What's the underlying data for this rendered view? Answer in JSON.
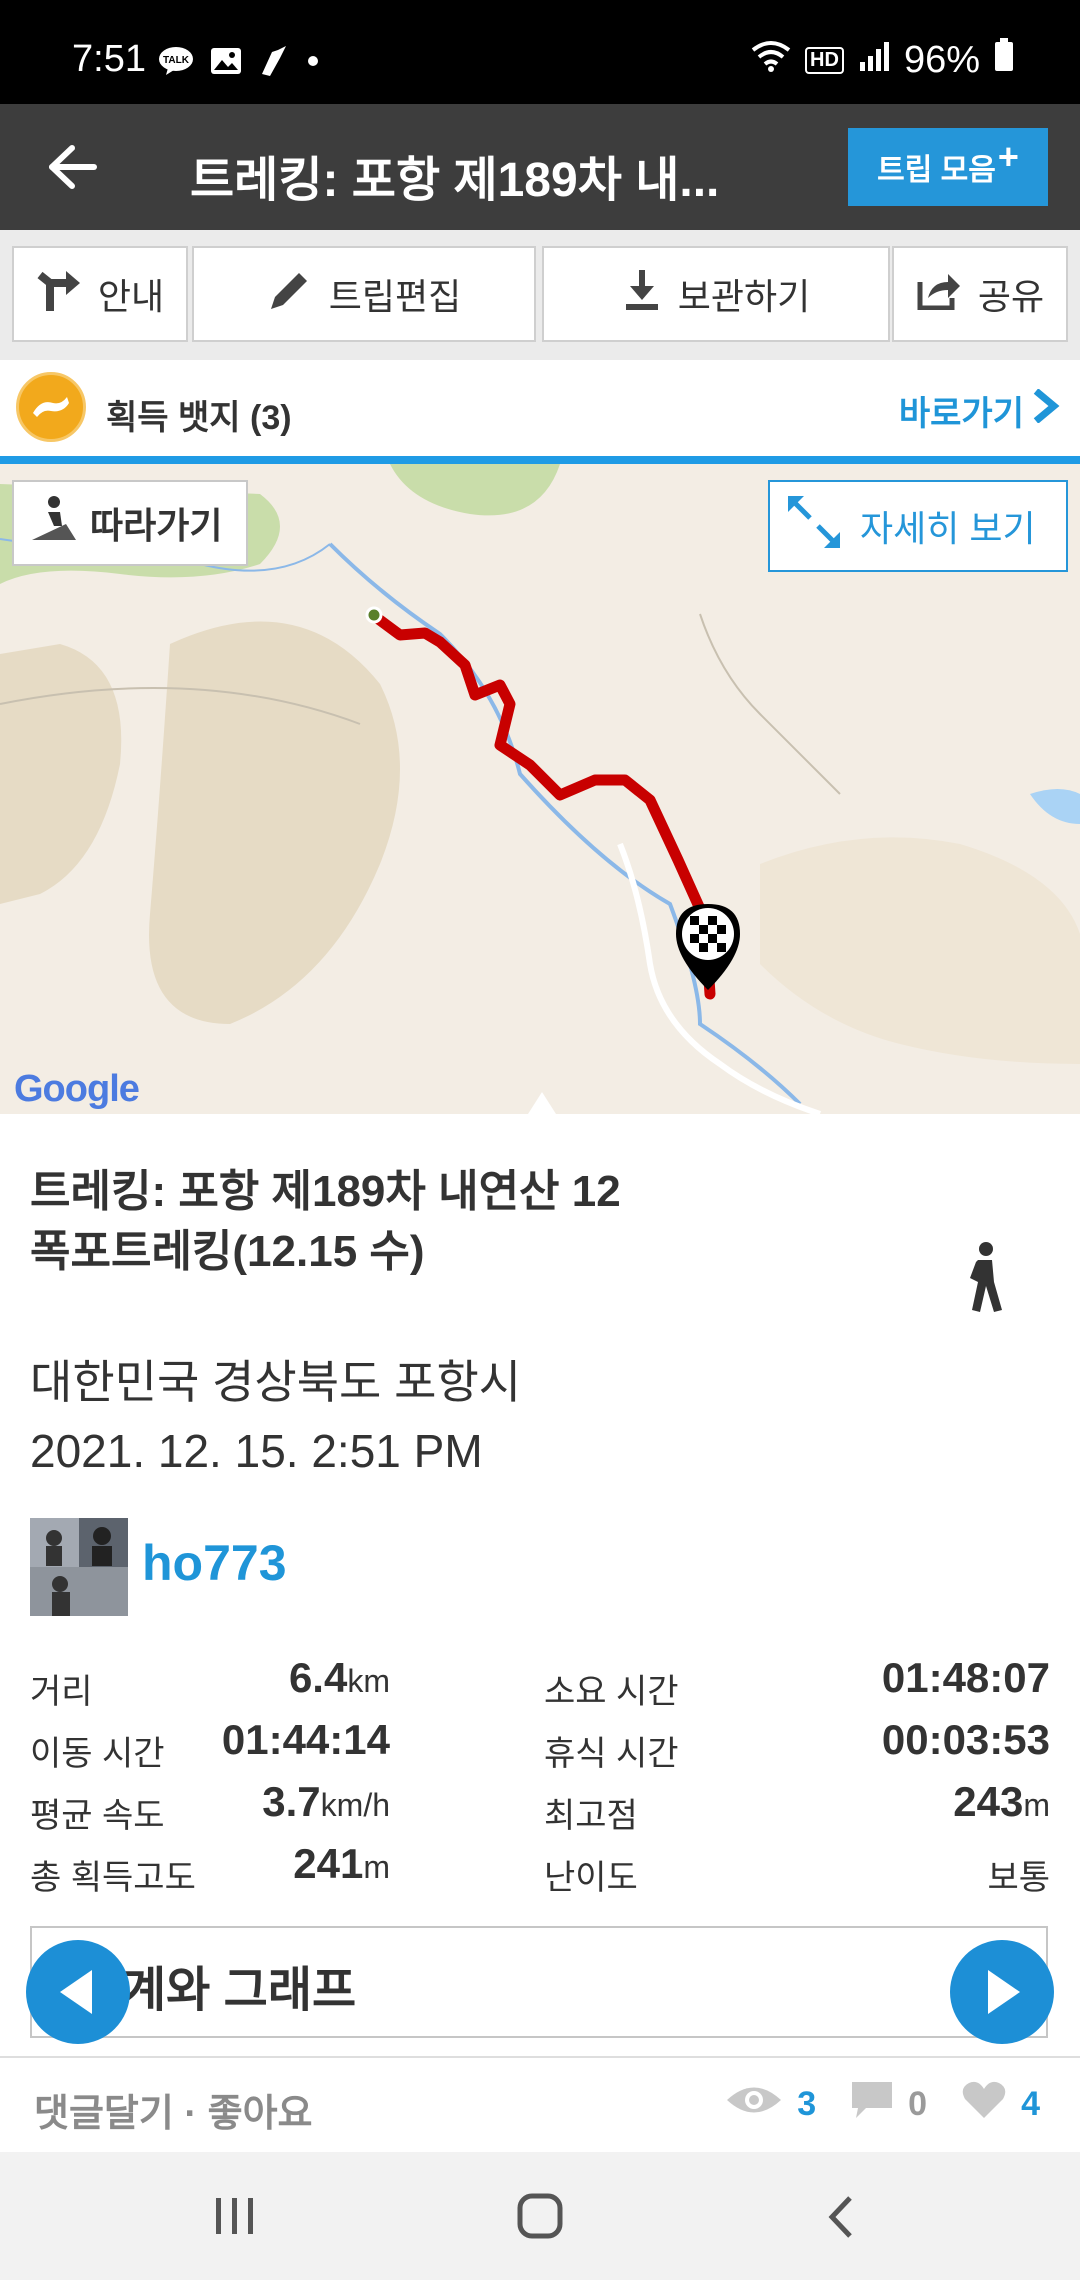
{
  "status_bar": {
    "time": "7:51",
    "battery": "96%",
    "hd_label": "HD"
  },
  "header": {
    "title": "트레킹: 포항 제189차  내...",
    "trip_collection_label": "트립 모음"
  },
  "toolbar": {
    "guide": "안내",
    "edit": "트립편집",
    "save": "보관하기",
    "share": "공유"
  },
  "badges": {
    "label": "획득 뱃지 (3)",
    "go": "바로가기"
  },
  "map": {
    "follow": "따라가기",
    "detail": "자세히 보기",
    "google": "Google"
  },
  "trip": {
    "title": "트레킹: 포항 제189차  내연산 12폭포트레킹(12.15 수)",
    "location": "대한민국 경상북도 포항시",
    "datetime": "2021. 12. 15. 2:51 PM",
    "user": "ho773"
  },
  "stats": [
    {
      "k1": "거리",
      "v1": "6.4",
      "u1": "km",
      "k2": "소요 시간",
      "v2": "01:48:07",
      "u2": ""
    },
    {
      "k1": "이동 시간",
      "v1": "01:44:14",
      "u1": "",
      "k2": "휴식 시간",
      "v2": "00:03:53",
      "u2": ""
    },
    {
      "k1": "평균 속도",
      "v1": "3.7",
      "u1": "km/h",
      "k2": "최고점",
      "v2": "243",
      "u2": "m"
    },
    {
      "k1": "총 획득고도",
      "v1": "241",
      "u1": "m",
      "k2": "난이도",
      "v2": "보통",
      "u2": ""
    }
  ],
  "graph": {
    "label": "계와 그래프"
  },
  "footer": {
    "links": "댓글달기 · 좋아요",
    "views": "3",
    "comments": "0",
    "likes": "4"
  },
  "colors": {
    "accent": "#1f95d8",
    "header_bg": "#3d3d3d",
    "route": "#c80000"
  }
}
